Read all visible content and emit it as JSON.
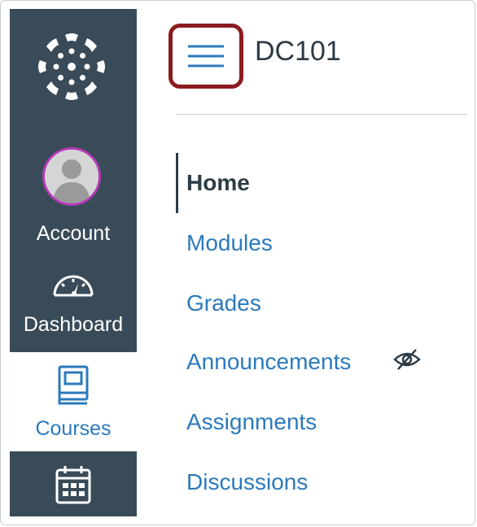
{
  "global_nav": {
    "account_label": "Account",
    "dashboard_label": "Dashboard",
    "courses_label": "Courses"
  },
  "header": {
    "course_title": "DC101"
  },
  "course_nav": {
    "items": [
      {
        "label": "Home",
        "active": true
      },
      {
        "label": "Modules"
      },
      {
        "label": "Grades"
      },
      {
        "label": "Announcements",
        "hidden_icon": "eye-slash-icon"
      },
      {
        "label": "Assignments"
      },
      {
        "label": "Discussions"
      }
    ]
  },
  "colors": {
    "nav_background": "#394b58",
    "link_blue": "#2b7abc",
    "text_dark": "#2d3b45",
    "highlight_border": "#8b1c1f",
    "avatar_ring": "#b43ab5"
  }
}
